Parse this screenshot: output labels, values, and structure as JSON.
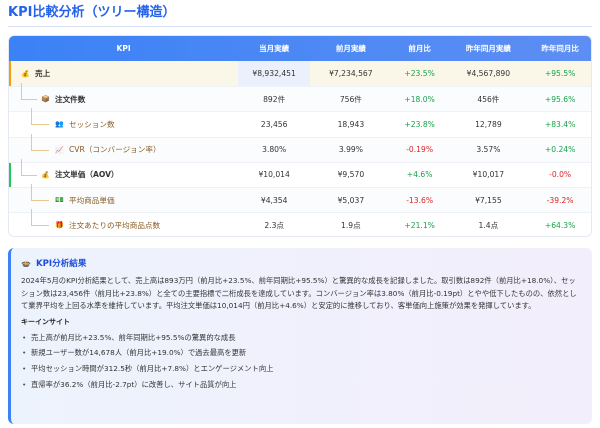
{
  "page": {
    "title": "KPI比較分析（ツリー構造）"
  },
  "table": {
    "headers": {
      "kpi": "KPI",
      "current": "当月実績",
      "prev": "前月実績",
      "mom": "前月比",
      "yoy_val": "昨年同月実績",
      "yoy": "昨年同月比"
    },
    "rows": [
      {
        "icon": "💰",
        "label": "売上",
        "current": "¥8,932,451",
        "prev": "¥7,234,567",
        "mom": "+23.5%",
        "yoy_val": "¥4,567,890",
        "yoy": "+95.5%",
        "mom_dir": "pos",
        "yoy_dir": "pos"
      },
      {
        "icon": "📦",
        "label": "注文件数",
        "current": "892件",
        "prev": "756件",
        "mom": "+18.0%",
        "yoy_val": "456件",
        "yoy": "+95.6%",
        "mom_dir": "pos",
        "yoy_dir": "pos"
      },
      {
        "icon": "👥",
        "label": "セッション数",
        "current": "23,456",
        "prev": "18,943",
        "mom": "+23.8%",
        "yoy_val": "12,789",
        "yoy": "+83.4%",
        "mom_dir": "pos",
        "yoy_dir": "pos"
      },
      {
        "icon": "📈",
        "label": "CVR（コンバージョン率）",
        "current": "3.80%",
        "prev": "3.99%",
        "mom": "-0.19%",
        "yoy_val": "3.57%",
        "yoy": "+0.24%",
        "mom_dir": "neg",
        "yoy_dir": "pos"
      },
      {
        "icon": "💰",
        "label": "注文単価（AOV）",
        "current": "¥10,014",
        "prev": "¥9,570",
        "mom": "+4.6%",
        "yoy_val": "¥10,017",
        "yoy": "-0.0%",
        "mom_dir": "pos",
        "yoy_dir": "neg"
      },
      {
        "icon": "💵",
        "label": "平均商品単価",
        "current": "¥4,354",
        "prev": "¥5,037",
        "mom": "-13.6%",
        "yoy_val": "¥7,155",
        "yoy": "-39.2%",
        "mom_dir": "neg",
        "yoy_dir": "neg"
      },
      {
        "icon": "🎁",
        "label": "注文あたりの平均商品点数",
        "current": "2.3点",
        "prev": "1.9点",
        "mom": "+21.1%",
        "yoy_val": "1.4点",
        "yoy": "+64.3%",
        "mom_dir": "pos",
        "yoy_dir": "pos"
      }
    ]
  },
  "summary": {
    "icon": "🍲",
    "title": "KPI分析結果",
    "body": "2024年5月のKPI分析結果として、売上高は893万円（前月比+23.5%、前年同期比+95.5%）と驚異的な成長を記録しました。取引数は892件（前月比+18.0%）、セッション数は23,456件（前月比+23.8%）と全ての主要指標で二桁成長を達成しています。コンバージョン率は3.80%（前月比-0.19pt）とやや低下したものの、依然として業界平均を上回る水準を維持しています。平均注文単価は10,014円（前月比+4.6%）と安定的に推移しており、客単価向上施策が効果を発揮しています。",
    "insight_heading": "キーインサイト",
    "insights": [
      "売上高が前月比+23.5%、前年同期比+95.5%の驚異的な成長",
      "新規ユーザー数が14,678人（前月比+19.0%）で過去最高を更新",
      "平均セッション時間が312.5秒（前月比+7.8%）とエンゲージメント向上",
      "直帰率が36.2%（前月比-2.7pt）に改善し、サイト品質が向上"
    ]
  }
}
